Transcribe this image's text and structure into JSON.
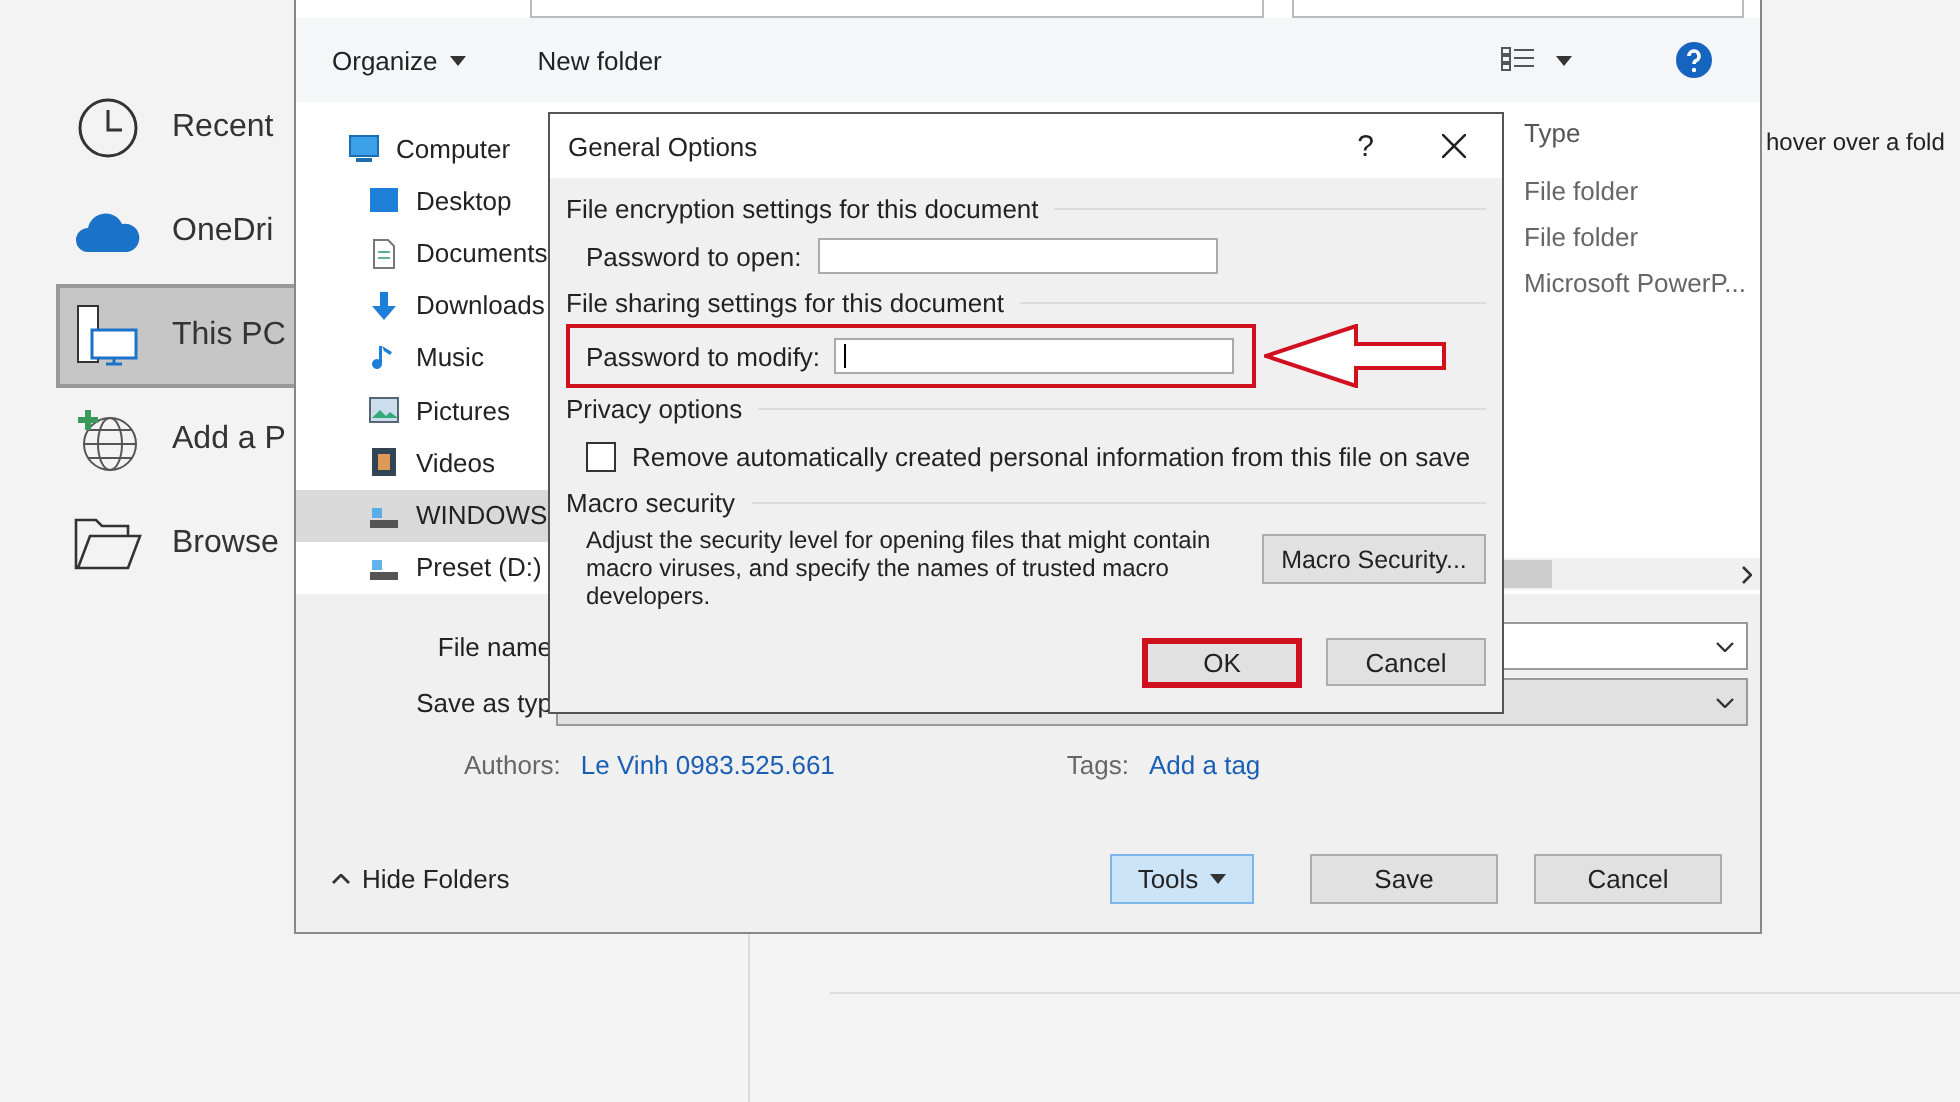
{
  "backstage": {
    "items": [
      {
        "label": "Recent",
        "selected": false
      },
      {
        "label": "OneDri",
        "selected": false
      },
      {
        "label": "This PC",
        "selected": true
      },
      {
        "label": "Add a P",
        "selected": false
      },
      {
        "label": "Browse",
        "selected": false
      }
    ]
  },
  "background_hint": "hover over a fold",
  "save_dialog": {
    "toolbar": {
      "organize": "Organize",
      "new_folder": "New folder"
    },
    "nav": [
      {
        "label": "Computer",
        "selected": false
      },
      {
        "label": "Desktop",
        "selected": false
      },
      {
        "label": "Documents",
        "selected": false
      },
      {
        "label": "Downloads",
        "selected": false
      },
      {
        "label": "Music",
        "selected": false
      },
      {
        "label": "Pictures",
        "selected": false
      },
      {
        "label": "Videos",
        "selected": false
      },
      {
        "label": "WINDOWS",
        "selected": true
      },
      {
        "label": "Preset (D:)",
        "selected": false
      }
    ],
    "file_list": {
      "column": "Type",
      "rows": [
        "File folder",
        "File folder",
        "Microsoft PowerP..."
      ]
    },
    "file_name_label": "File name",
    "save_as_type_label": "Save as typ",
    "authors_label": "Authors:",
    "authors": "Le Vinh 0983.525.661",
    "tags_label": "Tags:",
    "tags": "Add a tag",
    "hide_folders": "Hide Folders",
    "buttons": {
      "tools": "Tools",
      "save": "Save",
      "cancel": "Cancel"
    }
  },
  "general_options": {
    "title": "General Options",
    "help": "?",
    "encryption_heading": "File encryption settings for this document",
    "password_open_label": "Password to open:",
    "sharing_heading": "File sharing settings for this document",
    "password_modify_label": "Password to modify:",
    "privacy_heading": "Privacy options",
    "remove_personal_info": {
      "label": "Remove automatically created personal information from this file on save",
      "checked": false
    },
    "macro_heading": "Macro security",
    "macro_text": "Adjust the security level for opening files that might contain macro viruses, and specify the names of trusted macro developers.",
    "macro_button": "Macro Security...",
    "ok": "OK",
    "cancel": "Cancel"
  }
}
